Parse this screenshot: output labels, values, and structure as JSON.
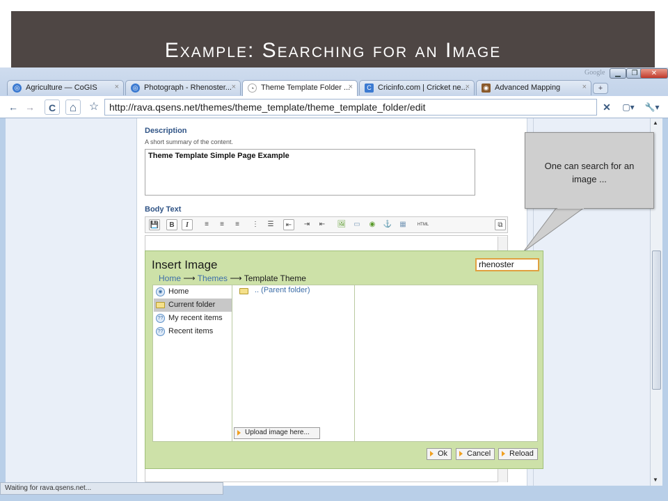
{
  "slide": {
    "title": "Example: Searching for an Image"
  },
  "browser": {
    "brand": "Google",
    "window_controls": {
      "minimize": "▁",
      "maximize": "❐",
      "close": "✕"
    },
    "tabs": [
      {
        "label": "Agriculture — CoGIS",
        "close": "×"
      },
      {
        "label": "Photograph - Rhenoster...",
        "close": "×"
      },
      {
        "label": "Theme Template Folder ...",
        "close": "×"
      },
      {
        "label": "Cricinfo.com | Cricket ne...",
        "close": "×"
      },
      {
        "label": "Advanced Mapping",
        "close": "×"
      }
    ],
    "new_tab": "+",
    "toolbar": {
      "back": "←",
      "forward": "→",
      "reload": "C",
      "home": "⌂",
      "bookmark": "☆",
      "stop": "✕",
      "page_menu": "▢▾",
      "tools_menu": "🔧▾"
    },
    "url": "http://rava.qsens.net/themes/theme_template/theme_template_folder/edit",
    "status": "Waiting for rava.qsens.net..."
  },
  "form": {
    "description_label": "Description",
    "description_help": "A short summary of the content.",
    "description_value": "Theme Template Simple Page Example",
    "body_text_label": "Body Text",
    "editor_buttons": [
      "💾",
      "B",
      "I",
      "≡",
      "≡",
      "≡",
      "⋮",
      "☰",
      "⇤",
      "⇥",
      "⇤",
      "🖼",
      "▭",
      "◉",
      "⚓",
      "▦",
      "HTML",
      "⧉"
    ]
  },
  "callout": {
    "text": "One can search for an image ..."
  },
  "dialog": {
    "title": "Insert Image",
    "search_value": "rhenoster",
    "breadcrumb": {
      "home": "Home",
      "sep": "⟶",
      "themes": "Themes",
      "current": "Template Theme"
    },
    "nav_items": [
      {
        "label": "Home"
      },
      {
        "label": "Current folder"
      },
      {
        "label": "My recent items"
      },
      {
        "label": "Recent items"
      }
    ],
    "parent_folder": ".. (Parent folder)",
    "upload_label": "Upload image here...",
    "buttons": {
      "ok": "Ok",
      "cancel": "Cancel",
      "reload": "Reload"
    }
  }
}
